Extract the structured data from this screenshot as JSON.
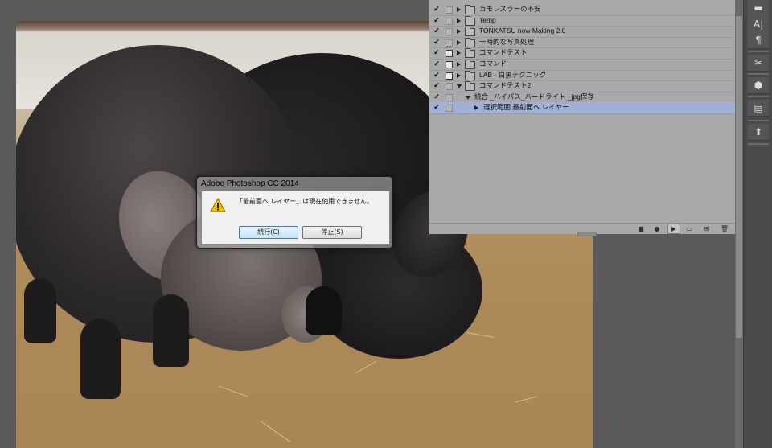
{
  "actions": {
    "rows": [
      {
        "label": "カモレスラーの不安",
        "check": "✔",
        "box": false,
        "expanded": false,
        "indent": 0,
        "kind": "set"
      },
      {
        "label": "Temp",
        "check": "✔",
        "box": false,
        "expanded": false,
        "indent": 0,
        "kind": "set"
      },
      {
        "label": "TONKATSU now Making 2.0",
        "check": "✔",
        "box": false,
        "expanded": false,
        "indent": 0,
        "kind": "set"
      },
      {
        "label": "一時的な写真処理",
        "check": "✔",
        "box": false,
        "expanded": false,
        "indent": 0,
        "kind": "set"
      },
      {
        "label": "コマンドテスト",
        "check": "✔",
        "box": true,
        "expanded": false,
        "indent": 0,
        "kind": "set"
      },
      {
        "label": "コマンド",
        "check": "✔",
        "box": true,
        "expanded": false,
        "indent": 0,
        "kind": "set"
      },
      {
        "label": "LAB - 白黒テクニック",
        "check": "✔",
        "box": true,
        "expanded": false,
        "indent": 0,
        "kind": "set"
      },
      {
        "label": "コマンドテスト2",
        "check": "✔",
        "box": false,
        "expanded": true,
        "indent": 0,
        "kind": "set"
      },
      {
        "label": "統合 _ハイパス_ハードライト _jpg保存",
        "check": "✔",
        "box": false,
        "expanded": true,
        "indent": 1,
        "kind": "action"
      },
      {
        "label": "選択範囲 最前面へ レイヤー",
        "check": "✔",
        "box": false,
        "expanded": false,
        "indent": 2,
        "kind": "step",
        "selected": true
      }
    ],
    "footer_buttons": [
      {
        "name": "stop-recording-icon",
        "glyph": "■"
      },
      {
        "name": "record-icon",
        "glyph": "●"
      },
      {
        "name": "play-icon",
        "glyph": "▶"
      },
      {
        "name": "new-set-icon",
        "glyph": "▭"
      },
      {
        "name": "new-action-icon",
        "glyph": "⊞"
      },
      {
        "name": "trash-icon",
        "glyph": "🗑"
      }
    ]
  },
  "tools": [
    {
      "name": "tool-preset-icon",
      "glyph": "▬"
    },
    {
      "name": "character-icon",
      "glyph": "A|"
    },
    {
      "name": "paragraph-icon",
      "glyph": "¶"
    },
    {
      "name": "tools-icon",
      "glyph": "✂"
    },
    {
      "name": "3d-icon",
      "glyph": "⬢"
    },
    {
      "name": "properties-icon",
      "glyph": "▤"
    },
    {
      "name": "clone-source-icon",
      "glyph": "⬆"
    }
  ],
  "dialog": {
    "title": "Adobe Photoshop CC 2014",
    "message": "「最前面へ レイヤー」は現在使用できません。",
    "continue_label": "続行(C)",
    "stop_label": "停止(S)"
  },
  "colors": {
    "selected_row": "#9fb1d6",
    "warning_yellow": "#f2c200"
  }
}
